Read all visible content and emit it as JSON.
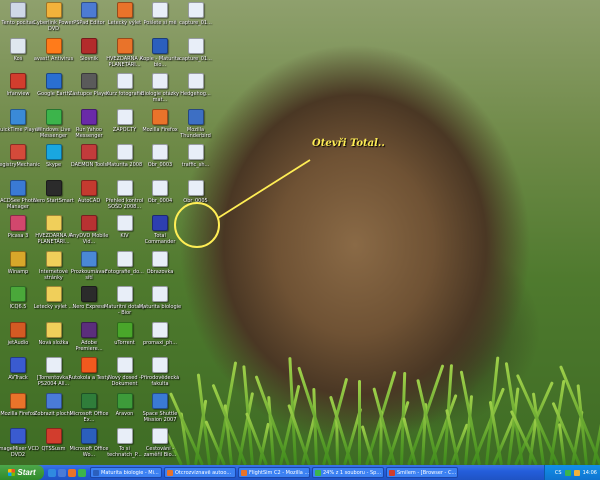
{
  "callout": {
    "text": "Otevři Total..",
    "target": "Total Commander"
  },
  "colors": {
    "callout": "#ffee55",
    "taskbar": "#245edb",
    "start": "#2f8a2a",
    "tray": "#1290e8"
  },
  "icons": [
    {
      "label": "Tento počítač",
      "glyph": "computer-icon",
      "color": "#cfd8e8",
      "col": 0,
      "row": 0
    },
    {
      "label": "Cyberlink Power DVD",
      "glyph": "dvd-icon",
      "color": "#f2b23b",
      "col": 1,
      "row": 0
    },
    {
      "label": "PSPad Editor",
      "glyph": "pspad-icon",
      "color": "#4c7bd3",
      "col": 2,
      "row": 0
    },
    {
      "label": "Letecký výlet",
      "glyph": "firefox-icon",
      "color": "#e9732a",
      "col": 3,
      "row": 0
    },
    {
      "label": "Pošlete si mě",
      "glyph": "document-icon",
      "color": "#e8eef8",
      "col": 4,
      "row": 0
    },
    {
      "label": "capture_01...",
      "glyph": "image-icon",
      "color": "#e8eef8",
      "col": 5,
      "row": 0
    },
    {
      "label": "Koš",
      "glyph": "recycle-bin-icon",
      "color": "#dfe7ef",
      "col": 0,
      "row": 1
    },
    {
      "label": "avast! Antivirus",
      "glyph": "avast-icon",
      "color": "#ff7b1a",
      "col": 1,
      "row": 1
    },
    {
      "label": "Slovník",
      "glyph": "dictionary-icon",
      "color": "#b32b2b",
      "col": 2,
      "row": 1
    },
    {
      "label": "HVĚZDÁRNA A PLANETÁRI...",
      "glyph": "firefox-icon",
      "color": "#e9732a",
      "col": 3,
      "row": 1
    },
    {
      "label": "Kopie - Maturita bio...",
      "glyph": "word-icon",
      "color": "#2b5fbd",
      "col": 4,
      "row": 1
    },
    {
      "label": "capture_01...",
      "glyph": "image-icon",
      "color": "#e8eef8",
      "col": 5,
      "row": 1
    },
    {
      "label": "Irfanview",
      "glyph": "irfanview-icon",
      "color": "#d23d2d",
      "col": 0,
      "row": 2
    },
    {
      "label": "Google Earth",
      "glyph": "google-earth-icon",
      "color": "#2a6fd1",
      "col": 1,
      "row": 2
    },
    {
      "label": "Zástupce Player",
      "glyph": "player-icon",
      "color": "#5a5a5a",
      "col": 2,
      "row": 2
    },
    {
      "label": "Kurz fotografie",
      "glyph": "document-icon",
      "color": "#e8eef8",
      "col": 3,
      "row": 2
    },
    {
      "label": "Biologie otázky mat...",
      "glyph": "document-icon",
      "color": "#e8eef8",
      "col": 4,
      "row": 2
    },
    {
      "label": "Hedgehog...",
      "glyph": "image-icon",
      "color": "#e8eef8",
      "col": 5,
      "row": 2
    },
    {
      "label": "QuickTime Player",
      "glyph": "quicktime-icon",
      "color": "#3a8ad8",
      "col": 0,
      "row": 3
    },
    {
      "label": "Windows Live Messenger",
      "glyph": "messenger-icon",
      "color": "#3cb44b",
      "col": 1,
      "row": 3
    },
    {
      "label": "Run Yahoo Messenger",
      "glyph": "yahoo-icon",
      "color": "#6a2aa8",
      "col": 2,
      "row": 3
    },
    {
      "label": "ZÁPOČTY",
      "glyph": "document-icon",
      "color": "#e8eef8",
      "col": 3,
      "row": 3
    },
    {
      "label": "Mozilla Firefox",
      "glyph": "firefox-icon",
      "color": "#e9732a",
      "col": 4,
      "row": 3
    },
    {
      "label": "Mozilla Thunderbird",
      "glyph": "thunderbird-icon",
      "color": "#3d6fc4",
      "col": 5,
      "row": 3
    },
    {
      "label": "RegistryMechanic",
      "glyph": "registry-icon",
      "color": "#d44a3a",
      "col": 0,
      "row": 4
    },
    {
      "label": "Skype",
      "glyph": "skype-icon",
      "color": "#19a7e0",
      "col": 1,
      "row": 4
    },
    {
      "label": "DAEMON Tools",
      "glyph": "daemon-icon",
      "color": "#c23b3b",
      "col": 2,
      "row": 4
    },
    {
      "label": "Maturita 2008",
      "glyph": "document-icon",
      "color": "#e8eef8",
      "col": 3,
      "row": 4
    },
    {
      "label": "Obr_0003",
      "glyph": "document-icon",
      "color": "#e8eef8",
      "col": 4,
      "row": 4
    },
    {
      "label": "traffic_sh...",
      "glyph": "document-icon",
      "color": "#e8eef8",
      "col": 5,
      "row": 4
    },
    {
      "label": "ACDSee Photo Manager",
      "glyph": "acdsee-icon",
      "color": "#3a7ad4",
      "col": 0,
      "row": 5
    },
    {
      "label": "Nero StartSmart",
      "glyph": "nero-icon",
      "color": "#2b2b2b",
      "col": 1,
      "row": 5
    },
    {
      "label": "AutoCAD",
      "glyph": "autocad-icon",
      "color": "#c43a2f",
      "col": 2,
      "row": 5
    },
    {
      "label": "Přehled kontrol SOŠD 2008...",
      "glyph": "document-icon",
      "color": "#e8eef8",
      "col": 3,
      "row": 5
    },
    {
      "label": "Obr_0004",
      "glyph": "document-icon",
      "color": "#e8eef8",
      "col": 4,
      "row": 5
    },
    {
      "label": "Obr_0005",
      "glyph": "document-icon",
      "color": "#e8eef8",
      "col": 5,
      "row": 5
    },
    {
      "label": "Total Commander",
      "glyph": "floppy-icon",
      "color": "#2d3fb0",
      "col": 4,
      "row": 6,
      "highlight": true
    },
    {
      "label": "Picasa 3",
      "glyph": "picasa-icon",
      "color": "#d2476d",
      "col": 0,
      "row": 6
    },
    {
      "label": "HVĚZDÁRNA A PLANETÁRI...",
      "glyph": "folder-icon",
      "color": "#f0cf5a",
      "col": 1,
      "row": 6
    },
    {
      "label": "AnyDVD Mobile Vid...",
      "glyph": "anydvd-icon",
      "color": "#b83232",
      "col": 2,
      "row": 6
    },
    {
      "label": "KIV",
      "glyph": "document-icon",
      "color": "#e8eef8",
      "col": 3,
      "row": 6
    },
    {
      "label": "Winamp",
      "glyph": "winamp-icon",
      "color": "#d8a72a",
      "col": 0,
      "row": 7
    },
    {
      "label": "Internetové stránky",
      "glyph": "folder-icon",
      "color": "#f0cf5a",
      "col": 1,
      "row": 7
    },
    {
      "label": "Prozkoumávač sítí",
      "glyph": "network-icon",
      "color": "#4a88d6",
      "col": 2,
      "row": 7
    },
    {
      "label": "Fotografie_do...",
      "glyph": "document-icon",
      "color": "#e8eef8",
      "col": 3,
      "row": 7
    },
    {
      "label": "Obrazovka",
      "glyph": "document-icon",
      "color": "#e8eef8",
      "col": 4,
      "row": 7
    },
    {
      "label": "ICQ6.5",
      "glyph": "icq-icon",
      "color": "#4aa83a",
      "col": 0,
      "row": 8
    },
    {
      "label": "Letecký výlet ...",
      "glyph": "folder-icon",
      "color": "#f0cf5a",
      "col": 1,
      "row": 8
    },
    {
      "label": "Nero Express",
      "glyph": "nero-icon",
      "color": "#2b2b2b",
      "col": 2,
      "row": 8
    },
    {
      "label": "Maturitní dotazy - Bior",
      "glyph": "document-icon",
      "color": "#e8eef8",
      "col": 3,
      "row": 8
    },
    {
      "label": "Maturita biologie",
      "glyph": "document-icon",
      "color": "#e8eef8",
      "col": 4,
      "row": 8
    },
    {
      "label": "jetAudio",
      "glyph": "jetaudio-icon",
      "color": "#d35a23",
      "col": 0,
      "row": 9
    },
    {
      "label": "Nová složka",
      "glyph": "folder-icon",
      "color": "#f0cf5a",
      "col": 1,
      "row": 9
    },
    {
      "label": "Adobe Premiere...",
      "glyph": "premiere-icon",
      "color": "#5b2e7c",
      "col": 2,
      "row": 9
    },
    {
      "label": "uTorrent",
      "glyph": "utorrent-icon",
      "color": "#49a62a",
      "col": 3,
      "row": 9
    },
    {
      "label": "promaxi_ph...",
      "glyph": "document-icon",
      "color": "#e8eef8",
      "col": 4,
      "row": 9
    },
    {
      "label": "AVTrack",
      "glyph": "avtrack-icon",
      "color": "#3a5bd0",
      "col": 0,
      "row": 10
    },
    {
      "label": "[Torrentovka] PS2004 All...",
      "glyph": "torrent-icon",
      "color": "#e8eef8",
      "col": 1,
      "row": 10
    },
    {
      "label": "Autokola a Testy",
      "glyph": "cone-icon",
      "color": "#f2591e",
      "col": 2,
      "row": 10
    },
    {
      "label": "Nový dosed - Dokument",
      "glyph": "document-icon",
      "color": "#e8eef8",
      "col": 3,
      "row": 10
    },
    {
      "label": "Přírodovědecká fakulta",
      "glyph": "document-icon",
      "color": "#e8eef8",
      "col": 4,
      "row": 10
    },
    {
      "label": "Mozilla Firefox",
      "glyph": "firefox-icon",
      "color": "#e9732a",
      "col": 0,
      "row": 11
    },
    {
      "label": "Zobrazit plochu",
      "glyph": "desktop-icon",
      "color": "#4a7bd8",
      "col": 1,
      "row": 11
    },
    {
      "label": "Microsoft Office Ex...",
      "glyph": "excel-icon",
      "color": "#2f7d3a",
      "col": 2,
      "row": 11
    },
    {
      "label": "Aravon",
      "glyph": "aravon-icon",
      "color": "#3d9b3a",
      "col": 3,
      "row": 11
    },
    {
      "label": "Space Shuttle Mission 2007",
      "glyph": "shuttle-icon",
      "color": "#3a7ad4",
      "col": 4,
      "row": 11
    },
    {
      "label": "ImageMixer VCD DVD2",
      "glyph": "imagemixer-icon",
      "color": "#3a5bd0",
      "col": 0,
      "row": 12
    },
    {
      "label": "QTSSusm",
      "glyph": "qtss-icon",
      "color": "#d23d2d",
      "col": 1,
      "row": 12
    },
    {
      "label": "Microsoft Office Wo...",
      "glyph": "word-icon",
      "color": "#2b5fbd",
      "col": 2,
      "row": 12
    },
    {
      "label": "To si technatch_P...",
      "glyph": "document-icon",
      "color": "#e8eef8",
      "col": 3,
      "row": 12
    },
    {
      "label": "Cestování - zaměřil Bio...",
      "glyph": "document-icon",
      "color": "#e8eef8",
      "col": 4,
      "row": 12
    }
  ],
  "taskbar": {
    "start_label": "Start",
    "quick_launch": [
      {
        "name": "ie-icon",
        "color": "#2f8ae0"
      },
      {
        "name": "desktop-icon",
        "color": "#4a7bd8"
      },
      {
        "name": "firefox-icon",
        "color": "#e9732a"
      },
      {
        "name": "messenger-icon",
        "color": "#3cb44b"
      }
    ],
    "tasks": [
      {
        "label": "Maturita biologie - Mi...",
        "color": "#2b5fbd"
      },
      {
        "label": "Otcrozvíznavě autoo...",
        "color": "#e9732a"
      },
      {
        "label": "FlightSim C2 - Mozilla ...",
        "color": "#e9732a"
      },
      {
        "label": "24% z 1 souboru - Sp...",
        "color": "#3cb44b"
      },
      {
        "label": "Smilem - [Browser - C...",
        "color": "#d23d2d"
      }
    ],
    "tray": {
      "language": "CS",
      "clock": "14:06"
    }
  }
}
